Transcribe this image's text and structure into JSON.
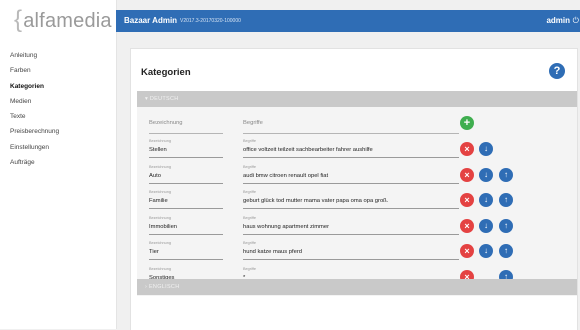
{
  "app": {
    "logo": "alfamedia",
    "title": "Bazaar Admin",
    "version": "V2017.3-20170320-100000",
    "user": "admin"
  },
  "sidebar": {
    "items": [
      {
        "label": "Anleitung",
        "active": false
      },
      {
        "label": "Farben",
        "active": false
      },
      {
        "label": "Kategorien",
        "active": true
      },
      {
        "label": "Medien",
        "active": false
      },
      {
        "label": "Texte",
        "active": false
      },
      {
        "label": "Preisberechnung",
        "active": false
      },
      {
        "label": "Einstellungen",
        "active": false
      },
      {
        "label": "Aufträge",
        "active": false
      }
    ]
  },
  "page": {
    "title": "Kategorien",
    "help_label": "?"
  },
  "sections": {
    "de_header": "▾ DEUTSCH",
    "en_header": "› ENGLISCH"
  },
  "new_row": {
    "name_placeholder": "Bezeichnung",
    "terms_placeholder": "Begriffe",
    "add_label": "+"
  },
  "field_labels": {
    "name": "Bezeichnung",
    "terms": "Begriffe"
  },
  "rows": [
    {
      "name": "Stellen",
      "terms": "office voltzeit teilzeit sachbearbeiter fahrer aushilfe",
      "has_down": true,
      "has_up": false
    },
    {
      "name": "Auto",
      "terms": "audi bmw citroen renault opel fiat",
      "has_down": true,
      "has_up": true
    },
    {
      "name": "Familie",
      "terms": "geburt glück tod mutter mama vater papa oma opa groß.",
      "has_down": true,
      "has_up": true
    },
    {
      "name": "Immobilien",
      "terms": "haus wohnung apartment zimmer",
      "has_down": true,
      "has_up": true
    },
    {
      "name": "Tier",
      "terms": "hund katze maus pferd",
      "has_down": true,
      "has_up": true
    },
    {
      "name": "Sonstiges",
      "terms": "*",
      "has_down": false,
      "has_up": true
    }
  ],
  "buttons": {
    "delete": "×",
    "down": "↓",
    "up": "↑"
  },
  "colors": {
    "brand_blue": "#2f6db5",
    "delete_red": "#e44242",
    "add_green": "#3fae4f"
  }
}
